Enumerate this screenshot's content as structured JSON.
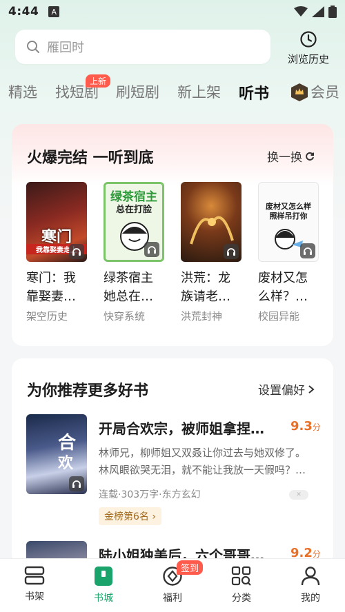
{
  "status_bar": {
    "time": "4:44",
    "notif_icon": "A"
  },
  "search": {
    "placeholder": "雁回时"
  },
  "history": {
    "label": "浏览历史"
  },
  "tabs": [
    {
      "label": "精选"
    },
    {
      "label": "找短剧",
      "badge": "上新"
    },
    {
      "label": "刷短剧"
    },
    {
      "label": "新上架"
    },
    {
      "label": "听书",
      "active": true
    },
    {
      "label": "会员"
    }
  ],
  "hot_section": {
    "title": "火爆完结 一听到底",
    "action": "换一换",
    "books": [
      {
        "title": "寒门：我靠娶妻…",
        "tag": "架空历史",
        "cover_text": "寒门",
        "cover_sub": "我靠娶妻走上"
      },
      {
        "title": "绿茶宿主她总在…",
        "tag": "快穿系统",
        "cover_text": "绿茶宿主",
        "cover_sub": "总在打脸"
      },
      {
        "title": "洪荒：龙族请老…",
        "tag": "洪荒封神",
        "cover_text": "",
        "cover_sub": ""
      },
      {
        "title": "废材又怎么样？…",
        "tag": "校园异能",
        "cover_text": "废材又怎么样",
        "cover_sub": "照样吊打你"
      }
    ]
  },
  "recommend_section": {
    "title": "为你推荐更多好书",
    "action": "设置偏好",
    "items": [
      {
        "title": "开局合欢宗，被师姐拿捏…",
        "score": "9.3",
        "score_unit": "分",
        "desc": "林师兄，柳师姐又双叒让你过去与她双修了。林风眼欲哭无泪，就不能让我放一天假吗？…",
        "meta": "连载·303万字·东方玄幻",
        "rank": "金榜第6名",
        "cover_text": "合欢宗"
      },
      {
        "title": "陆小姐独美后，六个哥哥…",
        "score": "9.2",
        "score_unit": "分"
      }
    ]
  },
  "bottom_nav": [
    {
      "label": "书架"
    },
    {
      "label": "书城",
      "active": true
    },
    {
      "label": "福利",
      "badge": "签到"
    },
    {
      "label": "分类"
    },
    {
      "label": "我的"
    }
  ],
  "colors": {
    "accent": "#1aa36a",
    "badge": "#ff5b4d",
    "score": "#e8712a"
  }
}
